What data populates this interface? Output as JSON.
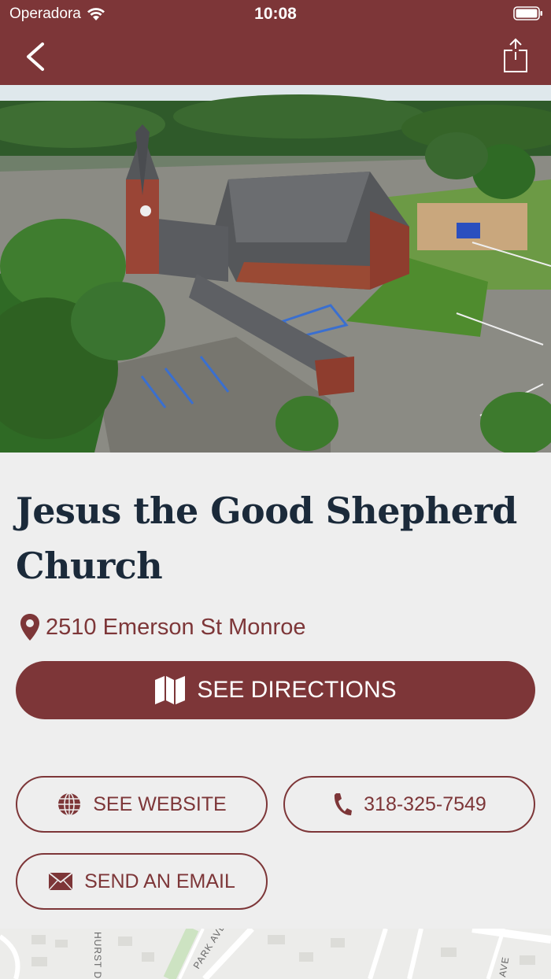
{
  "status_bar": {
    "carrier": "Operadora",
    "time": "10:08"
  },
  "nav": {
    "back_icon": "chevron-left-icon",
    "share_icon": "share-icon"
  },
  "hero": {
    "alt": "Aerial photo of church campus"
  },
  "church": {
    "name": "Jesus the Good Shepherd Church",
    "address": "2510 Emerson St Monroe"
  },
  "actions": {
    "directions_label": "SEE DIRECTIONS",
    "website_label": "SEE WEBSITE",
    "phone_label": "318-325-7549",
    "email_label": "SEND AN EMAIL"
  },
  "map": {
    "labels": [
      "PARK AVE",
      "HURST DR",
      "AVE"
    ]
  },
  "colors": {
    "brand": "#7d3638",
    "title": "#1b2a3a",
    "background": "#eeeeee"
  }
}
